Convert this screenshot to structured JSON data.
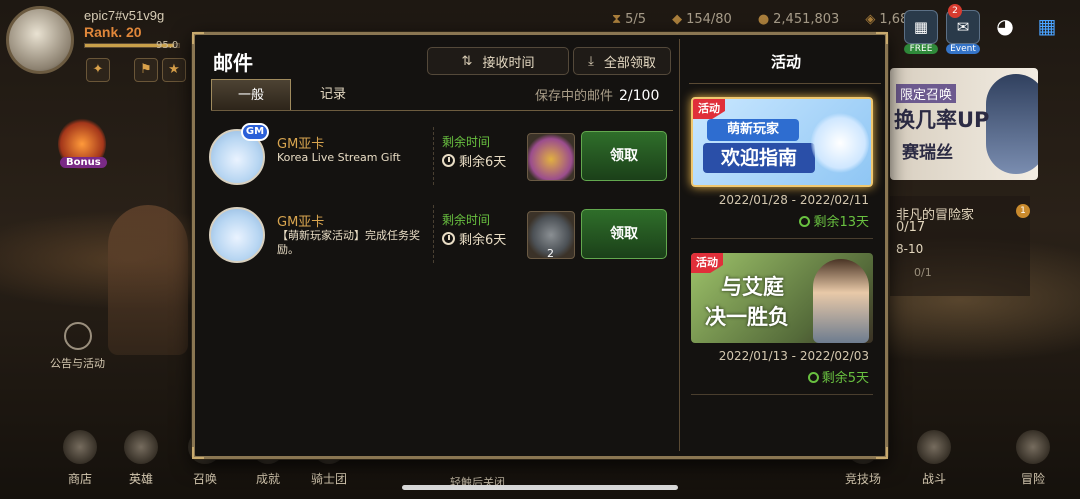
{
  "profile": {
    "name": "epic7#v51v9g",
    "rank": "Rank. 20",
    "xp_text": "95.0",
    "xp_fraction": 0.95
  },
  "resources": [
    {
      "icon": "stamina-icon",
      "value": "5/5"
    },
    {
      "icon": "crystal-icon",
      "value": "154/80"
    },
    {
      "icon": "gold-icon",
      "value": "2,451,803"
    },
    {
      "icon": "skystone-icon",
      "value": "1,680"
    }
  ],
  "top_buttons": [
    {
      "icon": "gift-icon",
      "label": "FREE"
    },
    {
      "icon": "mail-icon",
      "label": "Event",
      "badge": "2"
    },
    {
      "icon": "chat-icon",
      "label": ""
    },
    {
      "icon": "menu-grid-icon",
      "label": ""
    }
  ],
  "left": {
    "bonus": "Bonus",
    "notice": "公告与活动"
  },
  "background_banner": {
    "tag": "限定召唤",
    "line1": "换几率UP",
    "line2": "赛瑞丝"
  },
  "background_adventure": {
    "title": "非凡的冒险家",
    "progress": "0/17",
    "stage": "8-10",
    "count": "0/1",
    "badge": "1"
  },
  "mail": {
    "title": "邮件",
    "receive_time_button": "接收时间",
    "claim_all_button": "全部领取",
    "tabs": [
      "一般",
      "记录"
    ],
    "storage_label": "保存中的邮件",
    "storage_count": "2/100",
    "remaining_label": "剩余时间",
    "claim_label": "领取",
    "items": [
      {
        "sender": "GM亚卡",
        "body": "Korea Live Stream Gift",
        "remaining": "剩余6天",
        "reward_icon": "treasure-chest-icon",
        "reward_count": ""
      },
      {
        "sender": "GM亚卡",
        "body": "【萌新玩家活动】完成任务奖励。",
        "remaining": "剩余6天",
        "reward_icon": "stone-cube-icon",
        "reward_count": "2"
      }
    ]
  },
  "events": {
    "title": "活动",
    "tag": "活动",
    "items": [
      {
        "banner_line1": "萌新玩家",
        "banner_line2": "欢迎指南",
        "date": "2022/01/28 - 2022/02/11",
        "remaining": "剩余13天"
      },
      {
        "banner_line1": "与艾庭",
        "banner_line2": "决一胜负",
        "date": "2022/01/13 - 2022/02/03",
        "remaining": "剩余5天"
      }
    ]
  },
  "bottom_nav": [
    {
      "label": "商店",
      "icon": "scale-icon"
    },
    {
      "label": "英雄",
      "icon": "helmet-icon"
    },
    {
      "label": "召唤",
      "icon": "summon-icon"
    },
    {
      "label": "成就",
      "icon": "achievement-icon"
    },
    {
      "label": "骑士团",
      "icon": "guild-icon"
    },
    {
      "label": "竞技场",
      "icon": "arena-icon"
    },
    {
      "label": "战斗",
      "icon": "battle-icon"
    },
    {
      "label": "冒险",
      "icon": "adventure-icon"
    }
  ],
  "close_hint": "轻触后关闭"
}
